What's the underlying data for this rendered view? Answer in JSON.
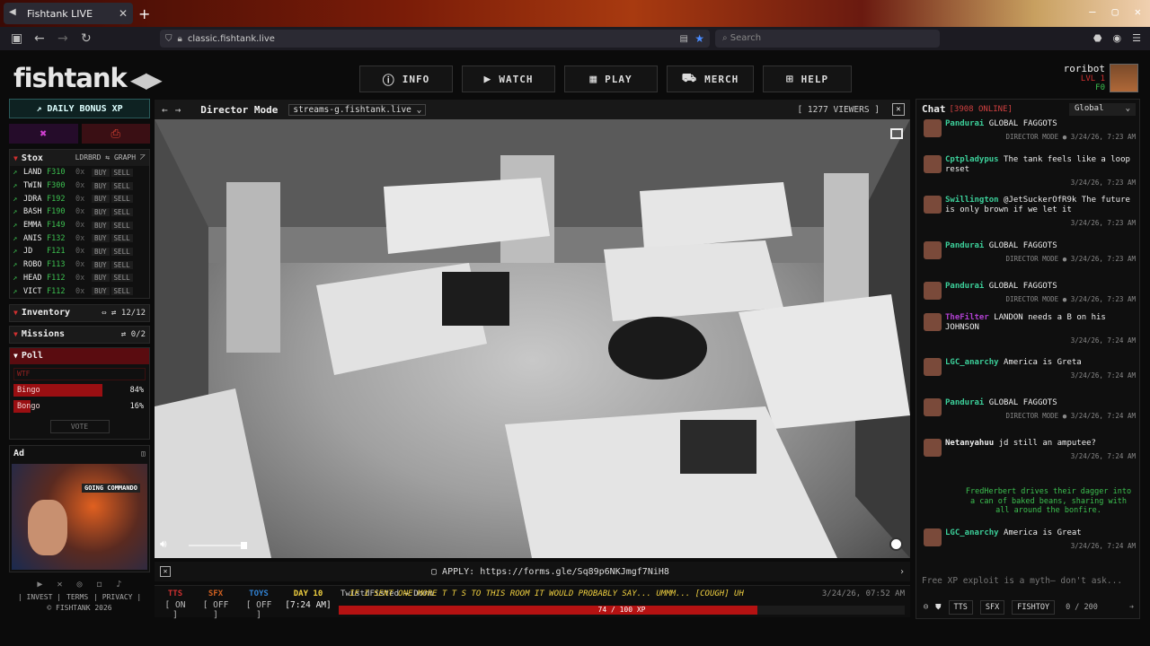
{
  "browser": {
    "tab_title": "Fishtank LIVE",
    "url": "classic.fishtank.live",
    "search_placeholder": "Search"
  },
  "logo": "fishtank",
  "nav": [
    "INFO",
    "WATCH",
    "PLAY",
    "MERCH",
    "HELP"
  ],
  "user": {
    "name": "roribot",
    "level": "LVL 1",
    "currency": "F0"
  },
  "left": {
    "daily_bonus": "DAILY BONUS XP",
    "stox": {
      "title": "Stox",
      "leaderboard": "LDRBRD",
      "graph": "GRAPH",
      "buy": "BUY",
      "sell": "SELL",
      "rows": [
        {
          "name": "LAND",
          "price": "F310",
          "qty": "0x"
        },
        {
          "name": "TWIN",
          "price": "F300",
          "qty": "0x"
        },
        {
          "name": "JDRA",
          "price": "F192",
          "qty": "0x"
        },
        {
          "name": "BASH",
          "price": "F190",
          "qty": "0x"
        },
        {
          "name": "EMMA",
          "price": "F149",
          "qty": "0x"
        },
        {
          "name": "ANIS",
          "price": "F132",
          "qty": "0x"
        },
        {
          "name": "JD",
          "price": "F121",
          "qty": "0x"
        },
        {
          "name": "ROBO",
          "price": "F113",
          "qty": "0x"
        },
        {
          "name": "HEAD",
          "price": "F112",
          "qty": "0x"
        },
        {
          "name": "VICT",
          "price": "F112",
          "qty": "0x"
        }
      ]
    },
    "inventory": {
      "title": "Inventory",
      "count": "12/12"
    },
    "missions": {
      "title": "Missions",
      "count": "0/2"
    },
    "poll": {
      "title": "Poll",
      "question": "WTF",
      "options": [
        {
          "label": "Bingo",
          "percent": "84%",
          "fraction": 0.84
        },
        {
          "label": "Bongo",
          "percent": "16%",
          "fraction": 0.16
        }
      ],
      "vote": "VOTE"
    },
    "ad": {
      "title": "Ad",
      "banner": "GOING COMMANDO"
    },
    "footer": {
      "invest": "INVEST",
      "terms": "TERMS",
      "privacy": "PRIVACY",
      "copyright": "© FISHTANK 2026"
    }
  },
  "video": {
    "mode": "Director Mode",
    "stream": "streams-g.fishtank.live",
    "viewers": "[ 1277 VIEWERS ]"
  },
  "apply": "APPLY: https://forms.gle/Sq89p6NKJmgf7NiH8",
  "bottom": {
    "tts": {
      "label": "TTS",
      "value": "[ ON ]"
    },
    "sfx": {
      "label": "SFX",
      "value": "[ OFF ]"
    },
    "toys": {
      "label": "TOYS",
      "value": "[ OFF ]"
    },
    "day": {
      "label": "DAY 10",
      "value": "[7:24 AM]"
    },
    "tts_user": "TwistdFisted → Dorm",
    "tts_message": "IF I SENT ONE MORE T T S TO THIS ROOM IT WOULD PROBABLY SAY... UMMM... [COUGH] UH",
    "tts_time": "3/24/26, 07:52 AM",
    "xp": "74 / 100 XP",
    "xp_fraction": 0.74
  },
  "chat": {
    "title": "Chat",
    "online": "[3908 ONLINE]",
    "channel": "Global",
    "messages": [
      {
        "user": "Pandurai",
        "text": "GLOBAL FAGGOTS",
        "meta": "DIRECTOR MODE ● 3/24/26, 7:23 AM"
      },
      {
        "user": "Cptpladypus",
        "text": "The tank feels like a loop reset",
        "meta": "3/24/26, 7:23 AM"
      },
      {
        "user": "Swillington",
        "text": "@JetSuckerOfR9k The future is only brown if we let it",
        "meta": "3/24/26, 7:23 AM"
      },
      {
        "user": "Pandurai",
        "text": "GLOBAL FAGGOTS",
        "meta": "DIRECTOR MODE ● 3/24/26, 7:23 AM"
      },
      {
        "user": "Pandurai",
        "text": "GLOBAL FAGGOTS",
        "meta": "DIRECTOR MODE ● 3/24/26, 7:23 AM"
      },
      {
        "user": "TheFilter",
        "text": "LANDON needs a B on his JOHNSON",
        "meta": "3/24/26, 7:24 AM"
      },
      {
        "user": "LGC_anarchy",
        "text": "America is Greta",
        "meta": "3/24/26, 7:24 AM"
      },
      {
        "user": "Pandurai",
        "text": "GLOBAL FAGGOTS",
        "meta": "DIRECTOR MODE ● 3/24/26, 7:24 AM"
      },
      {
        "user": "Netanyahuu",
        "text": "jd still an amputee?",
        "meta": "3/24/26, 7:24 AM"
      },
      {
        "user": "LGC_anarchy",
        "text": "America is Great",
        "meta": "3/24/26, 7:24 AM"
      }
    ],
    "system_message": "FredHerbert drives their dagger into a can of baked beans, sharing with all around the bonfire.",
    "input_placeholder": "Free XP exploit is a myth— don't ask...",
    "tts_btn": "TTS",
    "sfx_btn": "SFX",
    "fishtoy_btn": "FISHTOY",
    "char_count": "0 / 200"
  }
}
